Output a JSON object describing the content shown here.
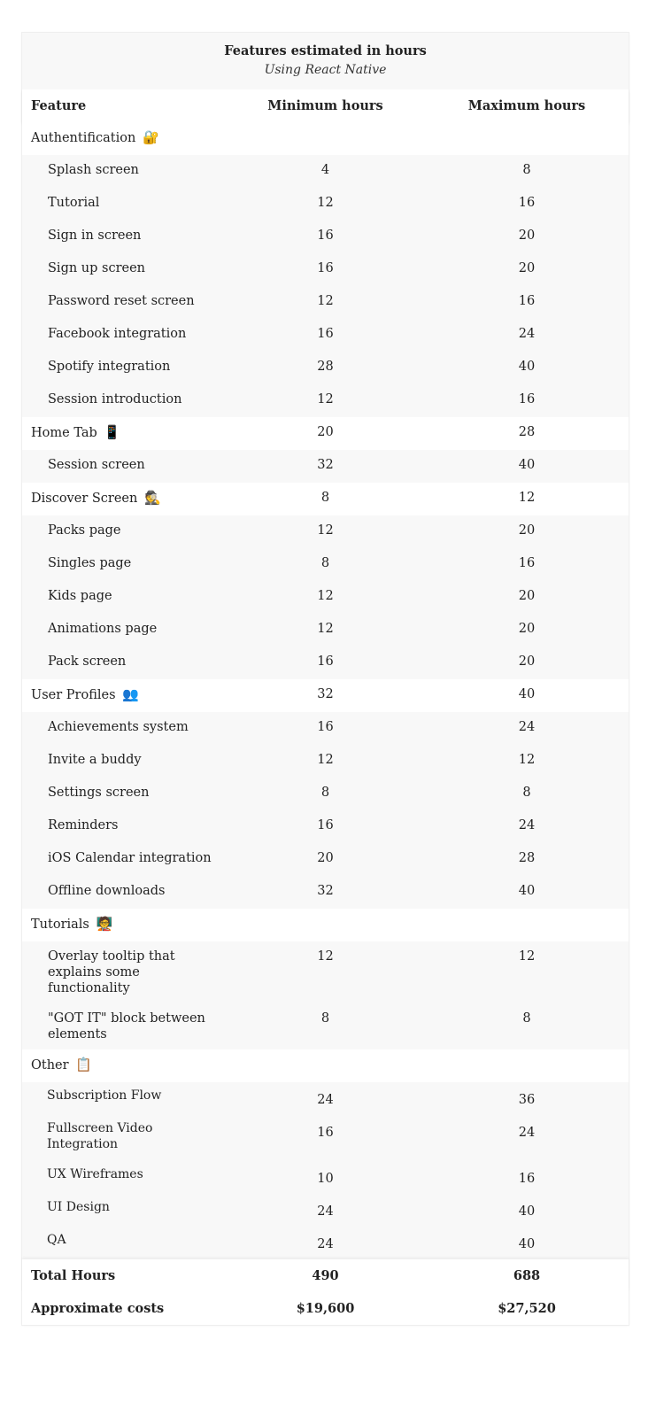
{
  "caption": {
    "title": "Features estimated in hours",
    "subtitle": "Using React Native"
  },
  "columns": [
    "Feature",
    "Minimum hours",
    "Maximum hours"
  ],
  "sections": [
    {
      "name": "Authentification",
      "icon": "lock-with-key-icon",
      "emoji": "🔐",
      "min": "",
      "max": "",
      "items": [
        {
          "name": "Splash screen",
          "min": "4",
          "max": "8"
        },
        {
          "name": "Tutorial",
          "min": "12",
          "max": "16"
        },
        {
          "name": "Sign in screen",
          "min": "16",
          "max": "20"
        },
        {
          "name": "Sign up screen",
          "min": "16",
          "max": "20"
        },
        {
          "name": "Password reset screen",
          "min": "12",
          "max": "16"
        },
        {
          "name": "Facebook integration",
          "min": "16",
          "max": "24"
        },
        {
          "name": "Spotify integration",
          "min": "28",
          "max": "40"
        },
        {
          "name": "Session introduction",
          "min": "12",
          "max": "16"
        }
      ]
    },
    {
      "name": "Home Tab",
      "icon": "mobile-phone-icon",
      "emoji": "📱",
      "min": "20",
      "max": "28",
      "items": [
        {
          "name": "Session screen",
          "min": "32",
          "max": "40"
        }
      ]
    },
    {
      "name": "Discover Screen",
      "icon": "detective-icon",
      "emoji": "🕵",
      "min": "8",
      "max": "12",
      "items": [
        {
          "name": "Packs page",
          "min": "12",
          "max": "20"
        },
        {
          "name": "Singles page",
          "min": "8",
          "max": "16"
        },
        {
          "name": "Kids page",
          "min": "12",
          "max": "20"
        },
        {
          "name": "Animations page",
          "min": "12",
          "max": "20"
        },
        {
          "name": "Pack screen",
          "min": "16",
          "max": "20"
        }
      ]
    },
    {
      "name": "User Profiles",
      "icon": "busts-in-silhouette-icon",
      "emoji": "👥",
      "min": "32",
      "max": "40",
      "items": [
        {
          "name": "Achievements system",
          "min": "16",
          "max": "24"
        },
        {
          "name": "Invite a buddy",
          "min": "12",
          "max": "12"
        },
        {
          "name": "Settings screen",
          "min": "8",
          "max": "8"
        },
        {
          "name": "Reminders",
          "min": "16",
          "max": "24"
        },
        {
          "name": "iOS Calendar integration",
          "min": "20",
          "max": "28"
        },
        {
          "name": "Offline downloads",
          "min": "32",
          "max": "40"
        }
      ]
    },
    {
      "name": "Tutorials",
      "icon": "teacher-icon",
      "emoji": "🧑‍🏫",
      "min": "",
      "max": "",
      "items": [
        {
          "name": "Overlay tooltip that explains some functionality",
          "min": "12",
          "max": "12"
        },
        {
          "name": "\"GOT IT\" block between elements",
          "min": "8",
          "max": "8"
        }
      ]
    },
    {
      "name": "Other",
      "icon": "clipboard-icon",
      "emoji": "📋",
      "min": "",
      "max": "",
      "items": [
        {
          "name": "Subscription Flow",
          "min": "24",
          "max": "36"
        },
        {
          "name": "Fullscreen Video Integration",
          "min": "16",
          "max": "24"
        },
        {
          "name": "UX Wireframes",
          "min": "10",
          "max": "16"
        },
        {
          "name": "UI Design",
          "min": "24",
          "max": "40"
        },
        {
          "name": "QA",
          "min": "24",
          "max": "40"
        }
      ]
    }
  ],
  "footer": {
    "total": {
      "label": "Total Hours",
      "min": "490",
      "max": "688"
    },
    "costs": {
      "label": "Approximate costs",
      "min": "$19,600",
      "max": "$27,520"
    }
  }
}
